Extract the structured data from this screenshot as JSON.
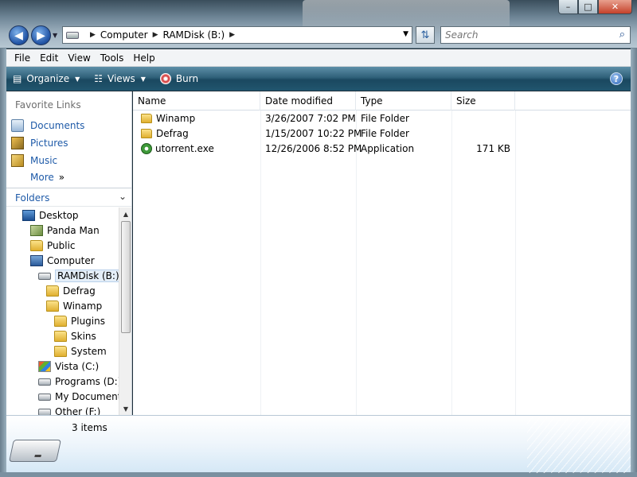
{
  "window": {
    "minimize_label": "–",
    "maximize_label": "□",
    "close_label": "✕"
  },
  "address": {
    "segments": [
      "Computer",
      "RAMDisk (B:)"
    ],
    "search_placeholder": "Search"
  },
  "menu": {
    "items": [
      "File",
      "Edit",
      "View",
      "Tools",
      "Help"
    ]
  },
  "commands": {
    "organize": "Organize",
    "views": "Views",
    "burn": "Burn",
    "help": "?"
  },
  "favorites": {
    "header": "Favorite Links",
    "items": [
      {
        "label": "Documents",
        "icon": "documents-icon"
      },
      {
        "label": "Pictures",
        "icon": "pictures-icon"
      },
      {
        "label": "Music",
        "icon": "music-icon"
      }
    ],
    "more": "More",
    "more_glyph": "»"
  },
  "folders": {
    "header": "Folders",
    "tree": [
      {
        "label": "Desktop",
        "icon": "desktop-icon",
        "depth": 0
      },
      {
        "label": "Panda Man",
        "icon": "user-folder-icon",
        "depth": 1
      },
      {
        "label": "Public",
        "icon": "folder-icon",
        "depth": 1
      },
      {
        "label": "Computer",
        "icon": "computer-icon",
        "depth": 1
      },
      {
        "label": "RAMDisk (B:)",
        "icon": "drive-icon",
        "depth": 2,
        "selected": true
      },
      {
        "label": "Defrag",
        "icon": "folder-icon",
        "depth": 3
      },
      {
        "label": "Winamp",
        "icon": "folder-icon",
        "depth": 3
      },
      {
        "label": "Plugins",
        "icon": "folder-icon",
        "depth": 4
      },
      {
        "label": "Skins",
        "icon": "folder-icon",
        "depth": 4
      },
      {
        "label": "System",
        "icon": "folder-icon",
        "depth": 4
      },
      {
        "label": "Vista (C:)",
        "icon": "vista-drive-icon",
        "depth": 2
      },
      {
        "label": "Programs (D:)",
        "icon": "drive-icon",
        "depth": 2
      },
      {
        "label": "My Document",
        "icon": "drive-icon",
        "depth": 2
      },
      {
        "label": "Other (F:)",
        "icon": "drive-icon",
        "depth": 2
      }
    ]
  },
  "filelist": {
    "columns": [
      "Name",
      "Date modified",
      "Type",
      "Size"
    ],
    "rows": [
      {
        "name": "Winamp",
        "date": "3/26/2007 7:02 PM",
        "type": "File Folder",
        "size": "",
        "icon": "folder-icon"
      },
      {
        "name": "Defrag",
        "date": "1/15/2007 10:22 PM",
        "type": "File Folder",
        "size": "",
        "icon": "folder-icon"
      },
      {
        "name": "utorrent.exe",
        "date": "12/26/2006 8:52 PM",
        "type": "Application",
        "size": "171 KB",
        "icon": "utorrent-icon"
      }
    ]
  },
  "details": {
    "count": "3 items"
  }
}
